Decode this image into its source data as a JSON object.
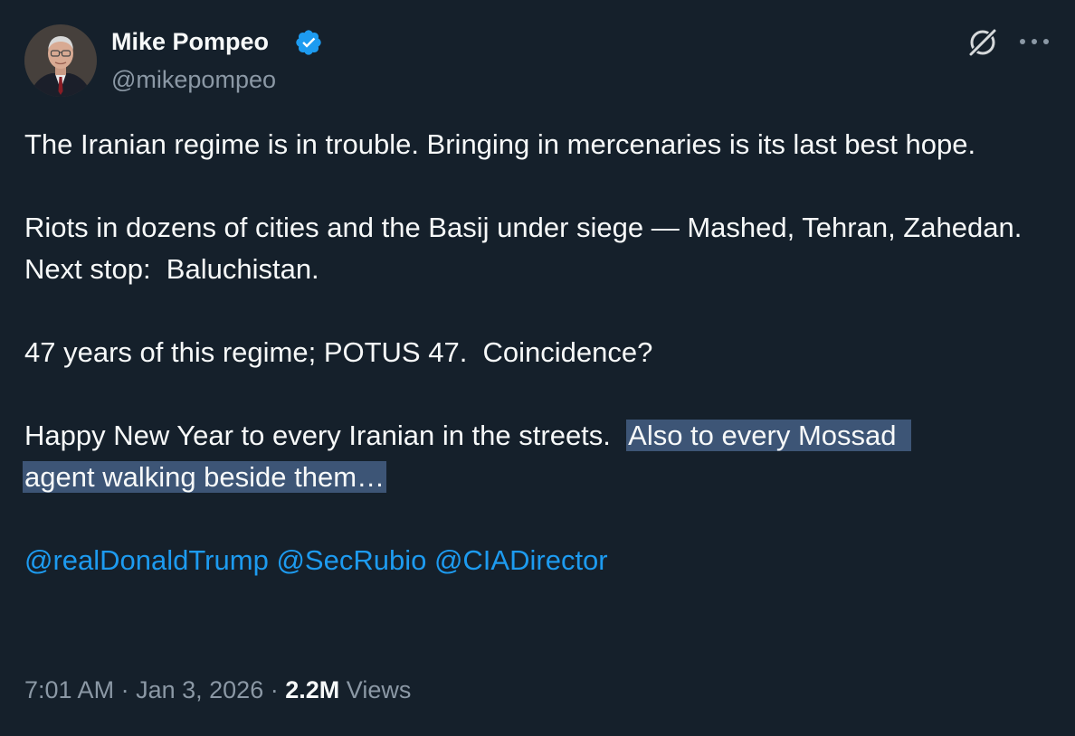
{
  "author": {
    "display_name": "Mike Pompeo",
    "handle": "@mikepompeo",
    "verified": true,
    "verified_color": "#1d9bf0"
  },
  "icons": {
    "avatar": "profile-photo",
    "verified": "verified-badge-icon",
    "grok": "grok-icon",
    "more": "more-options-icon"
  },
  "tweet": {
    "paragraphs": [
      "The Iranian regime is in trouble. Bringing in mercenaries is its last best hope.",
      "Riots in dozens of cities and the Basij under siege — Mashed, Tehran, Zahedan.  Next stop:  Baluchistan.",
      "47 years of this regime; POTUS 47.  Coincidence?"
    ],
    "final_paragraph_plain": "Happy New Year to every Iranian in the streets.  ",
    "final_paragraph_highlight_1": "Also to every Mossad",
    "final_paragraph_highlight_2": "agent walking beside them…",
    "mentions": [
      "@realDonaldTrump",
      "@SecRubio",
      "@CIADirector"
    ]
  },
  "meta": {
    "time": "7:01 AM",
    "separator": "·",
    "date": "Jan 3, 2026",
    "views_count": "2.2M",
    "views_label": "Views"
  },
  "colors": {
    "background": "#15202b",
    "text_primary": "#f7f9f9",
    "text_secondary": "#8b98a5",
    "link": "#1d9bf0",
    "selection_highlight": "#3d5576"
  }
}
